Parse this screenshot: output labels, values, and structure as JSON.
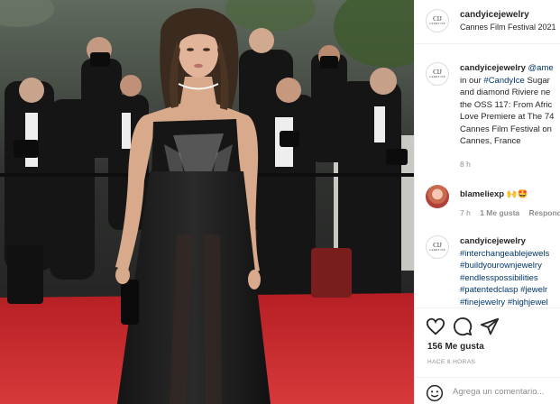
{
  "post": {
    "username": "candyicejewelry",
    "location": "Cannes Film Festival 2021",
    "avatar_monogram": "CIJ",
    "avatar_caption": "CANDY ICE"
  },
  "comments": [
    {
      "username": "candyicejewelry",
      "lines": [
        {
          "parts": [
            {
              "t": "candyicejewelry",
              "k": "u"
            },
            {
              "t": " ",
              "k": "p"
            },
            {
              "t": "@ame",
              "k": "tag"
            }
          ]
        },
        {
          "parts": [
            {
              "t": "in our ",
              "k": "p"
            },
            {
              "t": "#CandyIce",
              "k": "tag"
            },
            {
              "t": " Sugar",
              "k": "p"
            }
          ]
        },
        {
          "parts": [
            {
              "t": "and diamond Riviere ne",
              "k": "p"
            }
          ]
        },
        {
          "parts": [
            {
              "t": "the OSS 117: From Afric",
              "k": "p"
            }
          ]
        },
        {
          "parts": [
            {
              "t": "Love Premiere at The 74",
              "k": "p"
            }
          ]
        },
        {
          "parts": [
            {
              "t": "Cannes Film Festival on",
              "k": "p"
            }
          ]
        },
        {
          "parts": [
            {
              "t": "Cannes, France",
              "k": "p"
            }
          ]
        }
      ],
      "time": "8 h"
    },
    {
      "username": "blameliexp",
      "text": "🙌🤩",
      "time": "7 h",
      "likes": "1 Me gusta",
      "reply": "Respond"
    },
    {
      "username": "candyicejewelry",
      "lines": [
        {
          "parts": [
            {
              "t": "candyicejewelry",
              "k": "u"
            }
          ]
        },
        {
          "parts": [
            {
              "t": "#interchangeablejewels",
              "k": "tag"
            }
          ]
        },
        {
          "parts": [
            {
              "t": "#buildyourownjewelry",
              "k": "tag"
            }
          ]
        },
        {
          "parts": [
            {
              "t": "#endlesspossibilities",
              "k": "tag"
            }
          ]
        },
        {
          "parts": [
            {
              "t": "#patentedclasp",
              "k": "tag"
            },
            {
              "t": " ",
              "k": "p"
            },
            {
              "t": "#jewelr",
              "k": "tag"
            }
          ]
        },
        {
          "parts": [
            {
              "t": "#finejewelry",
              "k": "tag"
            },
            {
              "t": " ",
              "k": "p"
            },
            {
              "t": "#highjewel",
              "k": "tag"
            }
          ]
        }
      ]
    }
  ],
  "actions": {
    "likes": "156 Me gusta",
    "posted_ago": "HACE 8 HORAS",
    "comment_placeholder": "Agrega un comentario..."
  },
  "icons": [
    "heart-icon",
    "comment-icon",
    "share-icon",
    "emoji-icon"
  ],
  "colors": {
    "carpet": "#c8282a",
    "link": "#00376b",
    "muted": "#8e8e8e"
  }
}
